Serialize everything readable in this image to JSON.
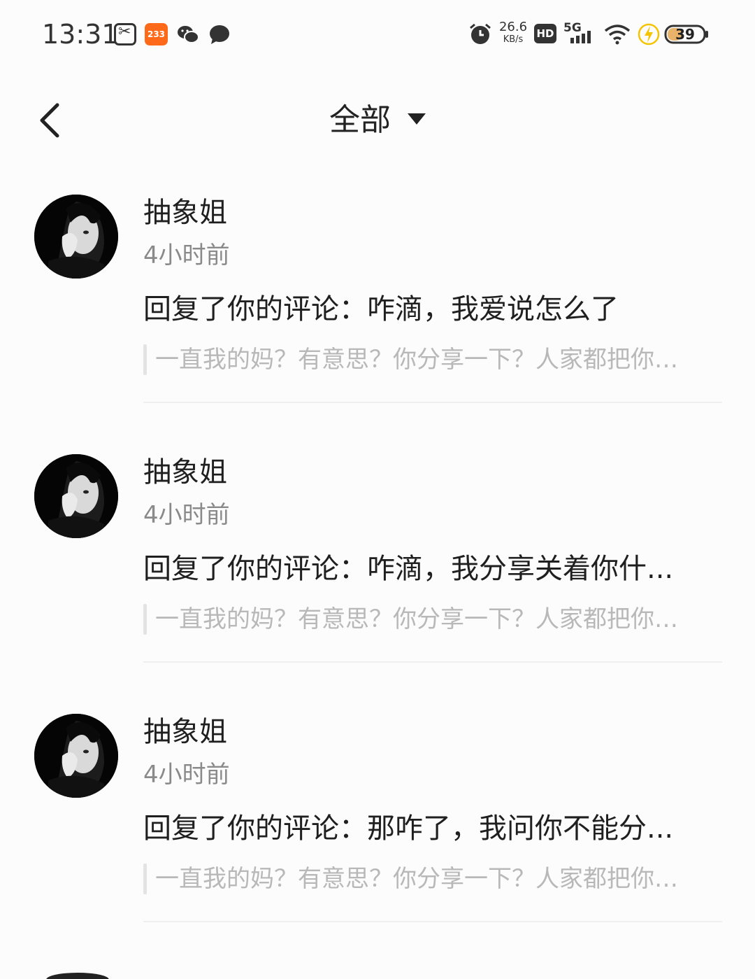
{
  "status_bar": {
    "time": "13:31",
    "app_badge": "233",
    "net_speed_value": "26.6",
    "net_speed_unit": "KB/s",
    "hd_label": "HD",
    "network_label": "5G",
    "battery_level": "39",
    "icons": [
      "scissors-app-icon",
      "app-233-icon",
      "wechat-icon",
      "message-icon",
      "alarm-icon",
      "hd-icon",
      "signal-icon",
      "wifi-icon",
      "charging-icon",
      "battery-icon"
    ]
  },
  "header": {
    "title": "全部",
    "back_icon": "chevron-left-icon",
    "dropdown_icon": "caret-down-icon"
  },
  "notifications": [
    {
      "username": "抽象姐",
      "time": "4小时前",
      "reply": "回复了你的评论：咋滴，我爱说怎么了",
      "quote": "一直我的妈？有意思？你分享一下？人家都把你…"
    },
    {
      "username": "抽象姐",
      "time": "4小时前",
      "reply": "回复了你的评论：咋滴，我分享关着你什...",
      "quote": "一直我的妈？有意思？你分享一下？人家都把你…"
    },
    {
      "username": "抽象姐",
      "time": "4小时前",
      "reply": "回复了你的评论：那咋了，我问你不能分...",
      "quote": "一直我的妈？有意思？你分享一下？人家都把你…"
    }
  ],
  "colors": {
    "background": "#fdfcfd",
    "text_primary": "#1f1f1f",
    "text_secondary": "#8a8a8a",
    "quote_text": "#b8b8b8",
    "quote_bar": "#e3e3e3",
    "divider": "#efefef",
    "app_badge": "#ff6a1a",
    "charging": "#f5c400"
  }
}
